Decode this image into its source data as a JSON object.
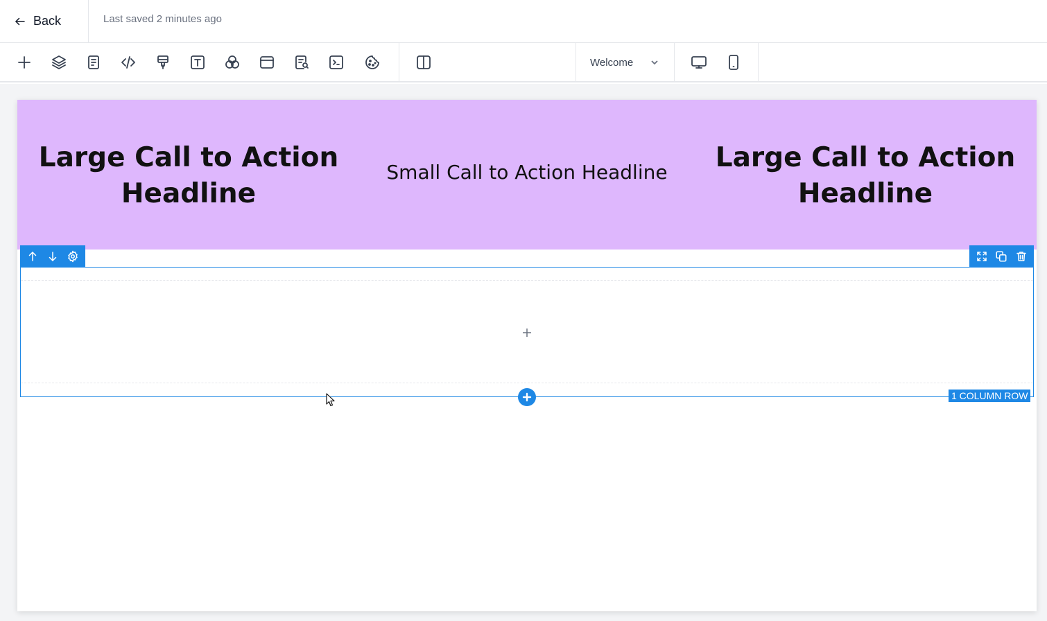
{
  "header": {
    "back_label": "Back",
    "saved_status": "Last saved 2 minutes ago"
  },
  "toolbar": {
    "tools": [
      "add-icon",
      "layers-icon",
      "document-icon",
      "code-icon",
      "paint-brush-icon",
      "text-icon",
      "color-circles-icon",
      "section-icon",
      "search-document-icon",
      "terminal-icon",
      "cookie-icon",
      "split-view-icon"
    ],
    "page_select": {
      "selected": "Welcome"
    },
    "devices": [
      "desktop-icon",
      "mobile-icon"
    ]
  },
  "canvas": {
    "cta_section": {
      "background": "#deb7fd",
      "left_headline": "Large Call to Action Headline",
      "center_headline": "Small Call to Action Headline",
      "right_headline": "Large Call to Action Headline"
    },
    "selected_row": {
      "badge": "1 COLUMN ROW",
      "accent": "#1e88e5"
    }
  }
}
